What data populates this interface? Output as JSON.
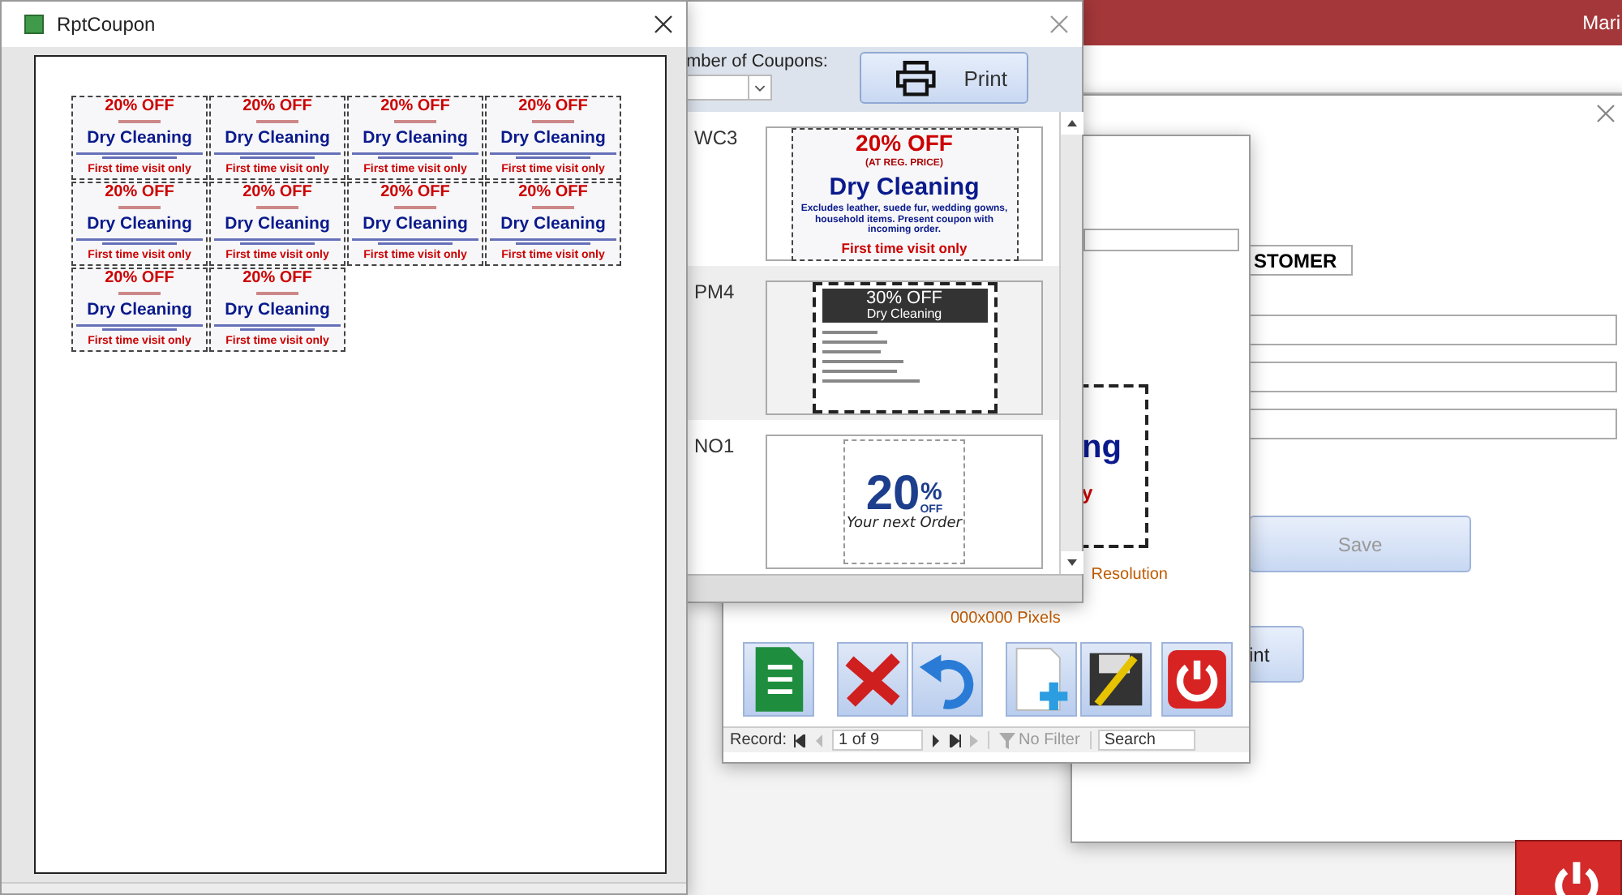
{
  "app": {
    "user": "Mari"
  },
  "report_window": {
    "title": "RptCoupon",
    "coupons": [
      {
        "headline": "20% OFF",
        "service": "Dry Cleaning",
        "footer": "First time visit only"
      },
      {
        "headline": "20% OFF",
        "service": "Dry Cleaning",
        "footer": "First time visit only"
      },
      {
        "headline": "20% OFF",
        "service": "Dry Cleaning",
        "footer": "First time visit only"
      },
      {
        "headline": "20% OFF",
        "service": "Dry Cleaning",
        "footer": "First time visit only"
      },
      {
        "headline": "20% OFF",
        "service": "Dry Cleaning",
        "footer": "First time visit only"
      },
      {
        "headline": "20% OFF",
        "service": "Dry Cleaning",
        "footer": "First time visit only"
      },
      {
        "headline": "20% OFF",
        "service": "Dry Cleaning",
        "footer": "First time visit only"
      },
      {
        "headline": "20% OFF",
        "service": "Dry Cleaning",
        "footer": "First time visit only"
      },
      {
        "headline": "20% OFF",
        "service": "Dry Cleaning",
        "footer": "First time visit only"
      },
      {
        "headline": "20% OFF",
        "service": "Dry Cleaning",
        "footer": "First time visit only"
      }
    ]
  },
  "coupon_picker": {
    "count_label": "mber of Coupons:",
    "print_button": "Print",
    "rows": [
      {
        "code": "WC3",
        "kind": "classic",
        "headline": "20% OFF",
        "note": "(AT REG. PRICE)",
        "service": "Dry Cleaning",
        "fine_print": "Excludes leather, suede fur, wedding gowns, household items. Present coupon with incoming order.",
        "footer": "First time visit only"
      },
      {
        "code": "PM4",
        "kind": "dark",
        "headline": "30% OFF",
        "service": "Dry Cleaning"
      },
      {
        "code": "NO1",
        "kind": "big",
        "number": "20",
        "percent": "%",
        "off": "OFF",
        "footer": "Your next Order"
      }
    ]
  },
  "coupon_form": {
    "preview_fragments": [
      "ng",
      "y"
    ],
    "resolution_label": "Resolution",
    "size_label": "000x000 Pixels",
    "record_nav": {
      "label": "Record:",
      "position": "1 of 9",
      "filter": "No Filter",
      "search": "Search"
    }
  },
  "customer_form": {
    "type_value": "STOMER",
    "save_button": {
      "label": "Save",
      "disabled": true
    },
    "print_button": "int"
  }
}
